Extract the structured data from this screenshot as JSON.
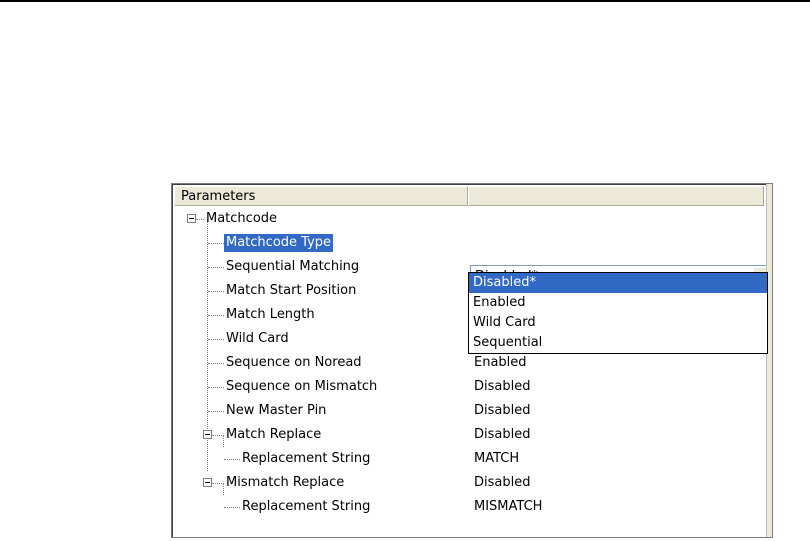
{
  "header": {
    "col1": "Parameters",
    "col2": ""
  },
  "tree": {
    "root": "Matchcode",
    "rows": [
      {
        "label": "Matchcode Type",
        "value": ""
      },
      {
        "label": "Sequential Matching",
        "value": ""
      },
      {
        "label": "Match Start Position",
        "value": ""
      },
      {
        "label": "Match Length",
        "value": ""
      },
      {
        "label": "Wild Card",
        "value": ""
      },
      {
        "label": "Sequence on Noread",
        "value": "Enabled"
      },
      {
        "label": "Sequence on Mismatch",
        "value": "Disabled"
      },
      {
        "label": "New Master Pin",
        "value": "Disabled"
      },
      {
        "label": "Match Replace",
        "value": "Disabled"
      },
      {
        "label": "Replacement String",
        "value": "MATCH"
      },
      {
        "label": "Mismatch Replace",
        "value": "Disabled"
      },
      {
        "label": "Replacement String",
        "value": "MISMATCH"
      }
    ]
  },
  "combo": {
    "selected": "Disabled*"
  },
  "dropdown": {
    "options": [
      "Disabled*",
      "Enabled",
      "Wild Card",
      "Sequential"
    ]
  },
  "colors": {
    "selection": "#316ac5",
    "header_bg": "#ece9d8"
  }
}
